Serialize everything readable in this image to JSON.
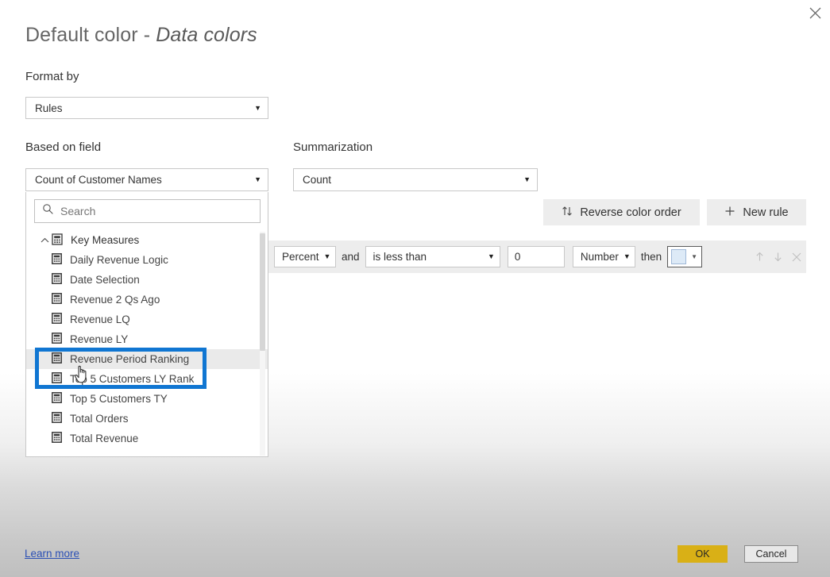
{
  "dialog": {
    "title_main": "Default color",
    "title_sep": " - ",
    "title_em": "Data colors",
    "close_icon": "close-icon"
  },
  "format_by": {
    "label": "Format by",
    "value": "Rules",
    "caret_icon": "chevron-down-icon"
  },
  "based_on_field": {
    "label": "Based on field",
    "value": "Count of Customer Names",
    "caret_icon": "chevron-down-icon"
  },
  "summarization": {
    "label": "Summarization",
    "value": "Count",
    "caret_icon": "chevron-down-icon"
  },
  "field_dropdown": {
    "search": {
      "placeholder": "Search",
      "value": "",
      "icon": "search-icon"
    },
    "group": {
      "label": "Key Measures",
      "expand_icon": "chevron-up-icon",
      "icon": "measure-table-icon"
    },
    "items": [
      {
        "label": "Daily Revenue Logic",
        "icon": "measure-icon",
        "hovered": false
      },
      {
        "label": "Date Selection",
        "icon": "measure-icon",
        "hovered": false
      },
      {
        "label": "Revenue 2 Qs Ago",
        "icon": "measure-icon",
        "hovered": false
      },
      {
        "label": "Revenue LQ",
        "icon": "measure-icon",
        "hovered": false
      },
      {
        "label": "Revenue LY",
        "icon": "measure-icon",
        "hovered": false
      },
      {
        "label": "Revenue Period Ranking",
        "icon": "measure-icon",
        "hovered": true
      },
      {
        "label": "Top 5 Customers LY Rank",
        "icon": "measure-icon",
        "hovered": false
      },
      {
        "label": "Top 5 Customers TY",
        "icon": "measure-icon",
        "hovered": false
      },
      {
        "label": "Total Orders",
        "icon": "measure-icon",
        "hovered": false
      },
      {
        "label": "Total Revenue",
        "icon": "measure-icon",
        "hovered": false
      }
    ]
  },
  "toolbar": {
    "reverse_label": "Reverse color order",
    "reverse_icon": "sort-updown-icon",
    "new_rule_label": "New rule",
    "new_rule_icon": "plus-icon"
  },
  "rule": {
    "unit": "Percent",
    "unit_caret_icon": "chevron-down-icon",
    "and_label": "and",
    "operator": "is less than",
    "operator_caret_icon": "chevron-down-icon",
    "threshold": "0",
    "value_type": "Number",
    "value_type_caret_icon": "chevron-down-icon",
    "then_label": "then",
    "color_hex": "#ddeaf7",
    "color_caret_icon": "chevron-down-icon",
    "move_up_icon": "arrow-up-icon",
    "move_down_icon": "arrow-down-icon",
    "delete_icon": "close-icon"
  },
  "footer": {
    "learn_more": "Learn more",
    "ok": "OK",
    "cancel": "Cancel"
  },
  "annotation": {
    "highlight_color": "#1076d2",
    "cursor_icon": "pointer-hand-cursor"
  }
}
